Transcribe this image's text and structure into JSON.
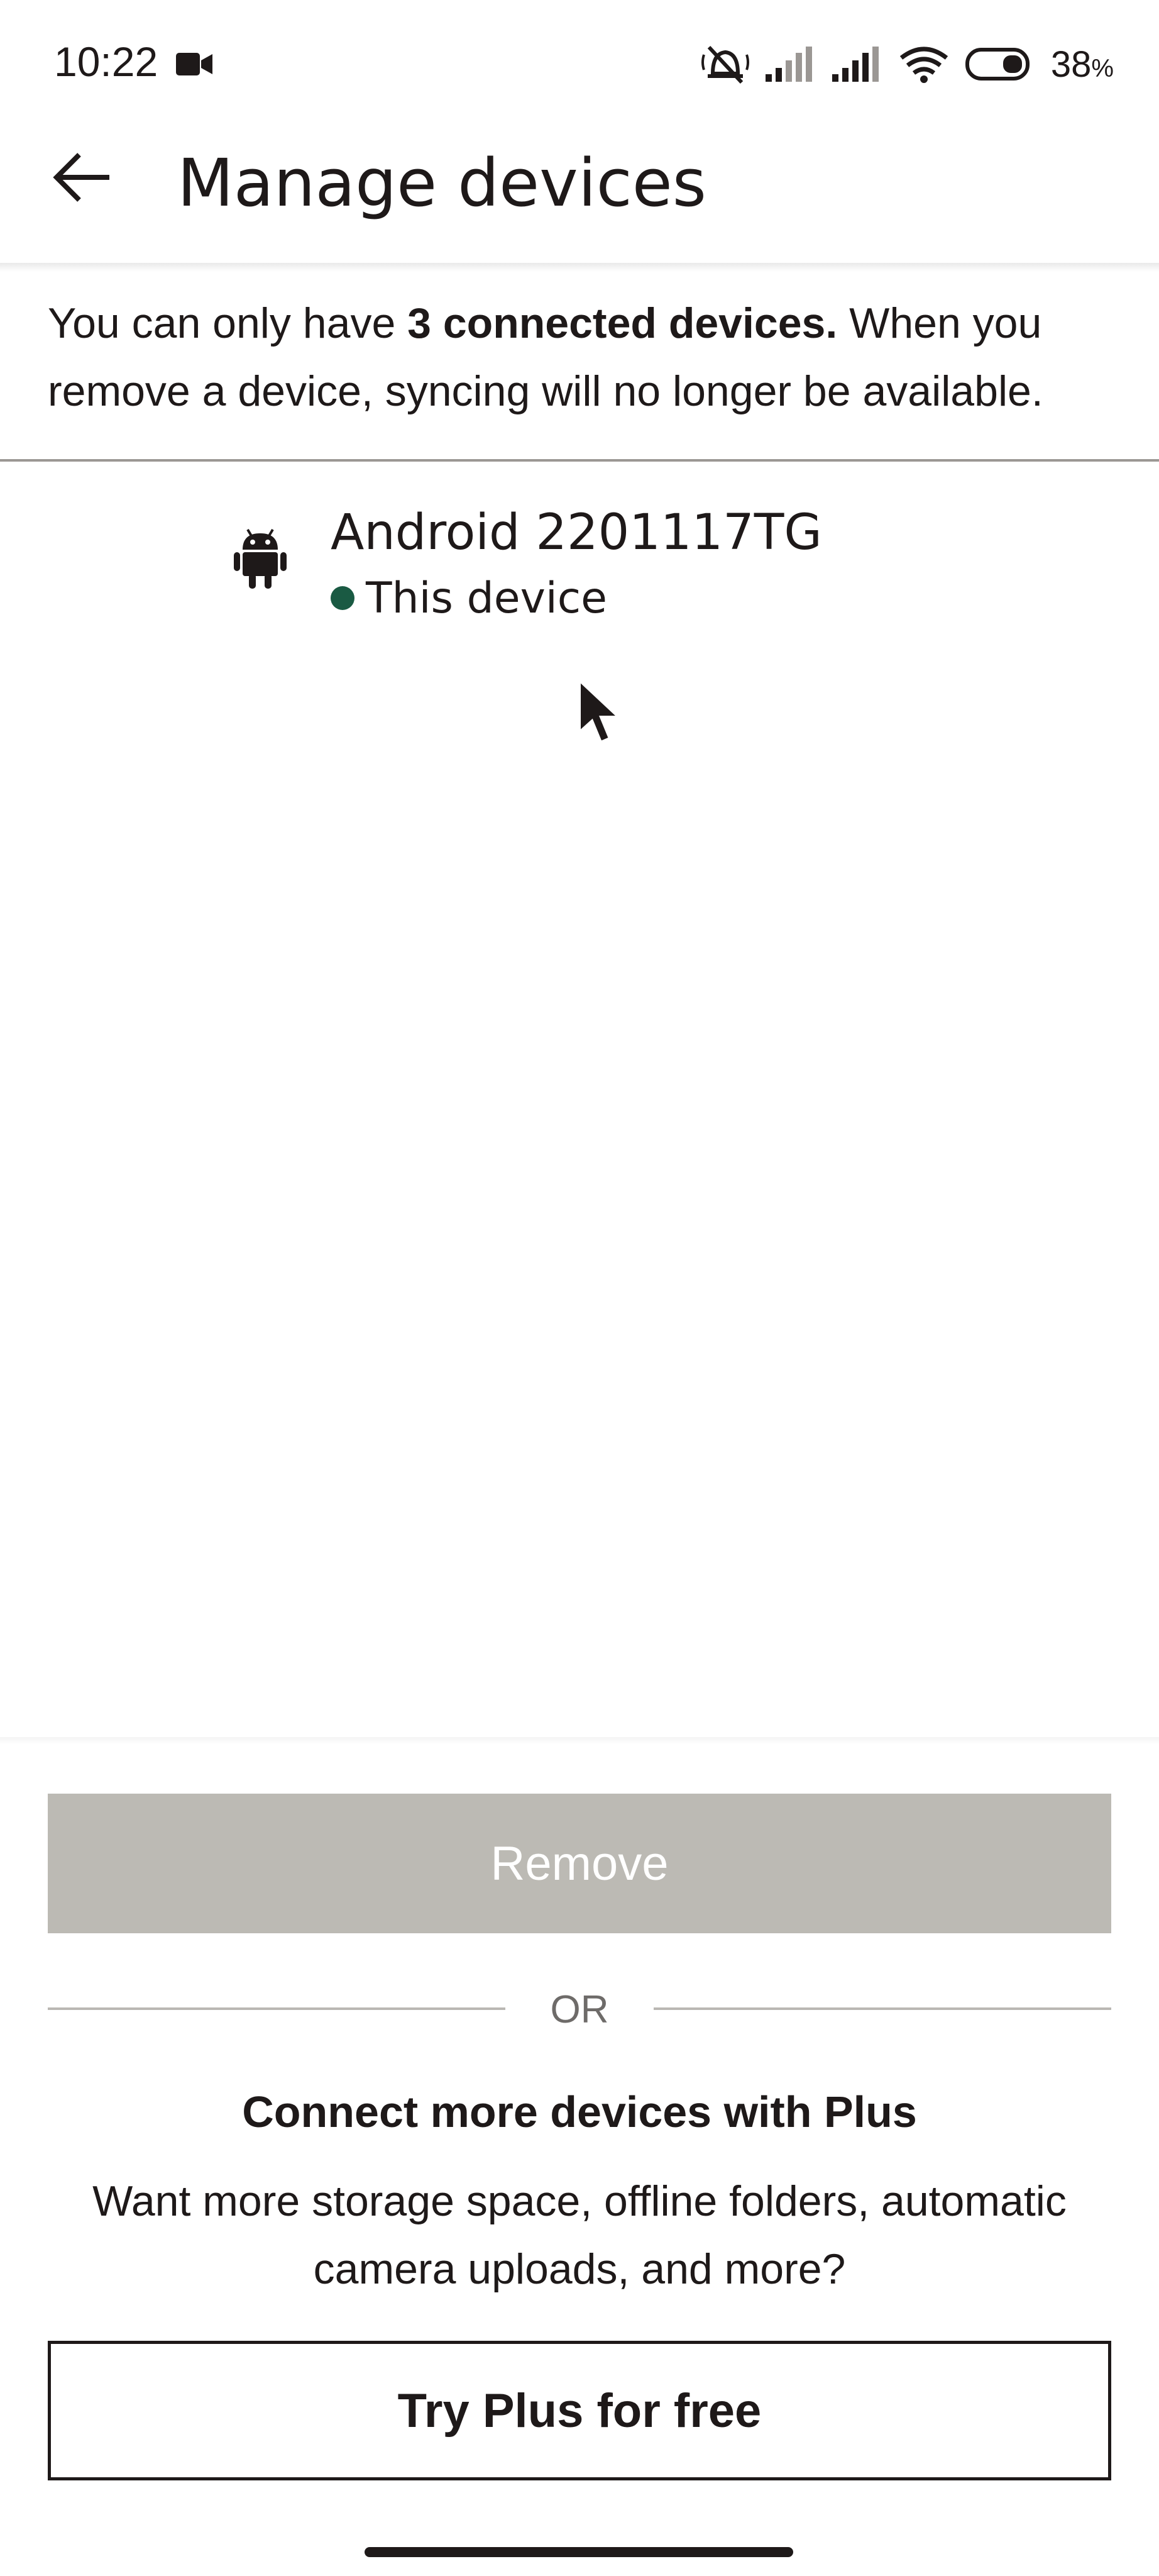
{
  "status_bar": {
    "time": "10:22",
    "battery_percent": "38",
    "battery_unit": "%",
    "icons": [
      "video-camera-icon",
      "mute-icon",
      "signal-icon",
      "signal-icon",
      "wifi-icon",
      "battery-icon"
    ]
  },
  "header": {
    "title": "Manage devices",
    "back_icon": "arrow-left-icon"
  },
  "info": {
    "prefix": "You can only have ",
    "bold": "3 connected devices.",
    "suffix": " When you remove a device, syncing will no longer be available."
  },
  "devices": [
    {
      "name": "Android 2201117TG",
      "status": "This device",
      "icon": "android-icon",
      "status_color": "#1a5a43"
    }
  ],
  "actions": {
    "remove_label": "Remove",
    "separator_label": "OR"
  },
  "upsell": {
    "title": "Connect more devices with Plus",
    "description": "Want more storage space, offline folders, automatic camera uploads, and more?",
    "cta_label": "Try Plus for free"
  },
  "colors": {
    "text": "#1e1919",
    "remove_disabled_bg": "#bcbab4",
    "status_green": "#1a5a43"
  }
}
